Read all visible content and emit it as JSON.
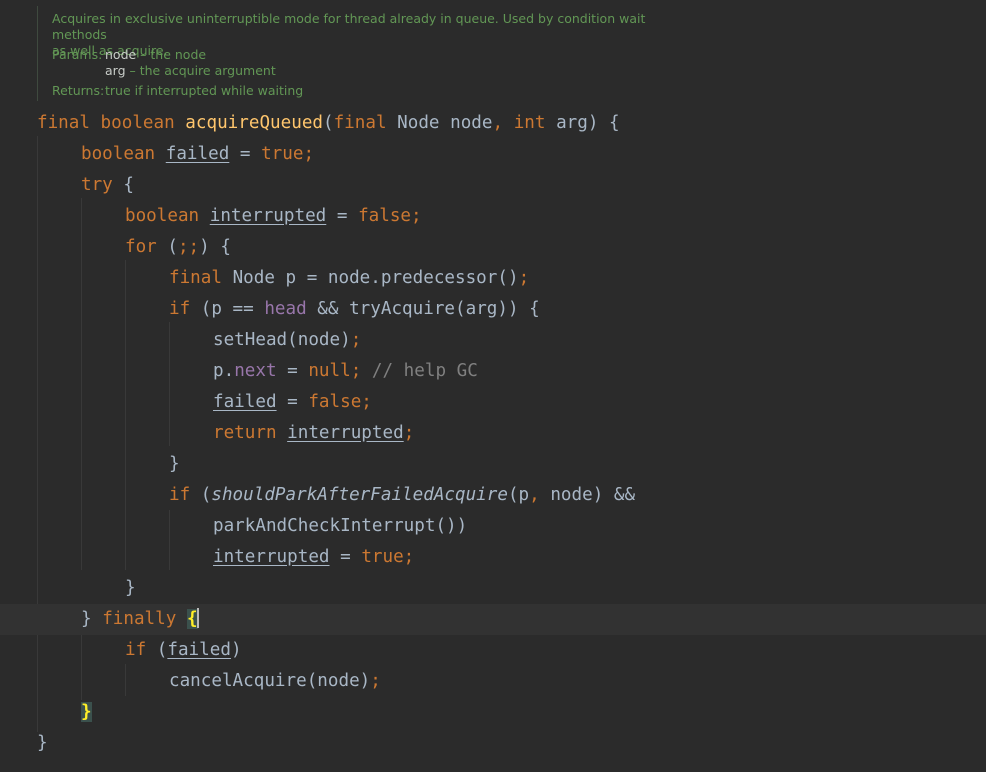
{
  "javadoc": {
    "description_line1": "Acquires in exclusive uninterruptible mode for thread already in queue. Used by condition wait methods",
    "description_line2": "as well as acquire.",
    "params_label": "Params:",
    "param1_name": "node",
    "param1_desc": " – the node",
    "param2_name": "arg",
    "param2_desc": " – the acquire argument",
    "returns_label": "Returns:",
    "returns_desc": "true if interrupted while waiting"
  },
  "code": {
    "l1": {
      "a": "final boolean ",
      "b": "acquireQueued",
      "c": "(",
      "d": "final ",
      "e": "Node node",
      "f": ", ",
      "g": "int ",
      "h": "arg) {"
    },
    "l2": {
      "a": "boolean ",
      "b": "failed",
      "c": " = ",
      "d": "true;"
    },
    "l3": {
      "a": "try ",
      "b": "{"
    },
    "l4": {
      "a": "boolean ",
      "b": "interrupted",
      "c": " = ",
      "d": "false;"
    },
    "l5": {
      "a": "for ",
      "b": "(",
      "c": ";;",
      "d": ") {"
    },
    "l6": {
      "a": "final ",
      "b": "Node p = node.predecessor()",
      "c": ";"
    },
    "l7": {
      "a": "if ",
      "b": "(p == ",
      "c": "head",
      "d": " && tryAcquire(arg)) {"
    },
    "l8": {
      "a": "setHead(node)",
      "b": ";"
    },
    "l9": {
      "a": "p.",
      "b": "next",
      "c": " = ",
      "d": "null; ",
      "e": "// help GC"
    },
    "l10": {
      "a": "failed",
      "b": " = ",
      "c": "false;"
    },
    "l11": {
      "a": "return ",
      "b": "interrupted",
      "c": ";"
    },
    "l12": {
      "a": "}"
    },
    "l13": {
      "a": "if ",
      "b": "(",
      "c": "shouldParkAfterFailedAcquire",
      "d": "(p",
      "e": ", ",
      "f": "node) &&"
    },
    "l14": {
      "a": "parkAndCheckInterrupt())"
    },
    "l15": {
      "a": "interrupted",
      "b": " = ",
      "c": "true;"
    },
    "l16": {
      "a": "}"
    },
    "l17": {
      "a": "} ",
      "b": "finally ",
      "c": "{"
    },
    "l18": {
      "a": "if ",
      "b": "(",
      "c": "failed",
      "d": ")"
    },
    "l19": {
      "a": "cancelAcquire(node)",
      "b": ";"
    },
    "l20": {
      "a": "}"
    },
    "l21": {
      "a": "}"
    }
  },
  "colors": {
    "background": "#2b2b2b",
    "keyword": "#cc7832",
    "method_declaration": "#ffc66d",
    "field": "#9876aa",
    "comment": "#808080",
    "default_text": "#a9b7c6",
    "javadoc": "#629755",
    "brace_match_highlight": "#3b514d",
    "brace_match_text": "#ffef28",
    "caret_line": "#323232"
  }
}
